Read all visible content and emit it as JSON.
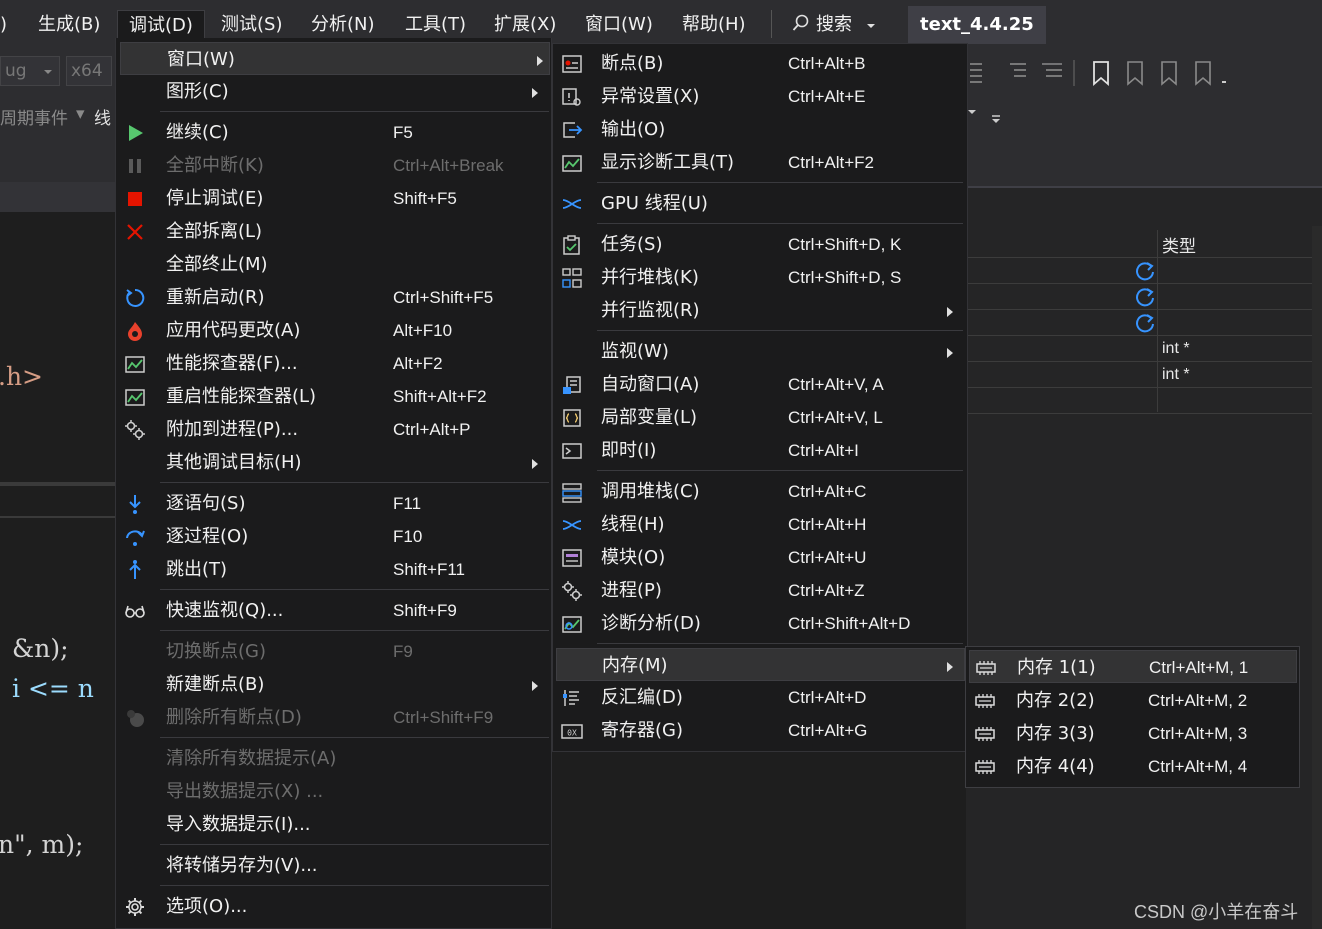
{
  "menubar": {
    "items": [
      ")",
      "生成(B)",
      "调试(D)",
      "测试(S)",
      "分析(N)",
      "工具(T)",
      "扩展(X)",
      "窗口(W)",
      "帮助(H)"
    ],
    "search_label": "搜索",
    "project_title": "text_4.4.25"
  },
  "toolbar": {
    "config": "ug",
    "platform": "x64"
  },
  "nav": {
    "lifecycle": "周期事件",
    "thread_prefix": "线"
  },
  "editor": {
    "code_lines": [
      ".h>",
      "&n);",
      "i <= n",
      "n\", m);"
    ]
  },
  "right_panel": {
    "column_header": "类型",
    "rows": [
      "",
      "",
      "",
      "int *",
      "int *",
      ""
    ]
  },
  "debug_menu": {
    "items": [
      {
        "label": "窗口(W)",
        "shortcut": "",
        "submenu": true,
        "icon": ""
      },
      {
        "label": "图形(C)",
        "shortcut": "",
        "submenu": true,
        "icon": ""
      },
      {
        "label": "继续(C)",
        "shortcut": "F5",
        "icon": "continue-icon"
      },
      {
        "label": "全部中断(K)",
        "shortcut": "Ctrl+Alt+Break",
        "disabled": true,
        "icon": "pause-icon"
      },
      {
        "label": "停止调试(E)",
        "shortcut": "Shift+F5",
        "icon": "stop-icon"
      },
      {
        "label": "全部拆离(L)",
        "shortcut": "",
        "icon": "detach-icon"
      },
      {
        "label": "全部终止(M)",
        "shortcut": "",
        "icon": ""
      },
      {
        "label": "重新启动(R)",
        "shortcut": "Ctrl+Shift+F5",
        "icon": "restart-icon"
      },
      {
        "label": "应用代码更改(A)",
        "shortcut": "Alt+F10",
        "icon": "hot-reload-icon"
      },
      {
        "label": "性能探查器(F)...",
        "shortcut": "Alt+F2",
        "icon": "profiler-icon"
      },
      {
        "label": "重启性能探查器(L)",
        "shortcut": "Shift+Alt+F2",
        "icon": "profiler-restart-icon"
      },
      {
        "label": "附加到进程(P)...",
        "shortcut": "Ctrl+Alt+P",
        "icon": "attach-icon"
      },
      {
        "label": "其他调试目标(H)",
        "shortcut": "",
        "submenu": true,
        "icon": ""
      },
      {
        "label": "逐语句(S)",
        "shortcut": "F11",
        "icon": "step-into-icon"
      },
      {
        "label": "逐过程(O)",
        "shortcut": "F10",
        "icon": "step-over-icon"
      },
      {
        "label": "跳出(T)",
        "shortcut": "Shift+F11",
        "icon": "step-out-icon"
      },
      {
        "label": "快速监视(Q)...",
        "shortcut": "Shift+F9",
        "icon": "glasses-icon"
      },
      {
        "label": "切换断点(G)",
        "shortcut": "F9",
        "disabled": true,
        "icon": ""
      },
      {
        "label": "新建断点(B)",
        "shortcut": "",
        "submenu": true,
        "icon": ""
      },
      {
        "label": "删除所有断点(D)",
        "shortcut": "Ctrl+Shift+F9",
        "disabled": true,
        "icon": "delete-breakpoints-icon"
      },
      {
        "label": "清除所有数据提示(A)",
        "shortcut": "",
        "disabled": true,
        "icon": ""
      },
      {
        "label": "导出数据提示(X) ...",
        "shortcut": "",
        "disabled": true,
        "icon": ""
      },
      {
        "label": "导入数据提示(I)...",
        "shortcut": "",
        "icon": ""
      },
      {
        "label": "将转储另存为(V)...",
        "shortcut": "",
        "icon": ""
      },
      {
        "label": "选项(O)...",
        "shortcut": "",
        "icon": "gear-icon"
      }
    ]
  },
  "window_menu": {
    "items": [
      {
        "label": "断点(B)",
        "shortcut": "Ctrl+Alt+B",
        "icon": "breakpoints-window-icon"
      },
      {
        "label": "异常设置(X)",
        "shortcut": "Ctrl+Alt+E",
        "icon": "exception-settings-icon"
      },
      {
        "label": "输出(O)",
        "shortcut": "",
        "icon": "output-icon"
      },
      {
        "label": "显示诊断工具(T)",
        "shortcut": "Ctrl+Alt+F2",
        "icon": "diagnostics-icon"
      },
      {
        "label": "GPU 线程(U)",
        "shortcut": "",
        "icon": "gpu-threads-icon"
      },
      {
        "label": "任务(S)",
        "shortcut": "Ctrl+Shift+D, K",
        "icon": "tasks-icon"
      },
      {
        "label": "并行堆栈(K)",
        "shortcut": "Ctrl+Shift+D, S",
        "icon": "parallel-stacks-icon"
      },
      {
        "label": "并行监视(R)",
        "shortcut": "",
        "submenu": true,
        "icon": ""
      },
      {
        "label": "监视(W)",
        "shortcut": "",
        "submenu": true,
        "icon": ""
      },
      {
        "label": "自动窗口(A)",
        "shortcut": "Ctrl+Alt+V, A",
        "icon": "autos-icon"
      },
      {
        "label": "局部变量(L)",
        "shortcut": "Ctrl+Alt+V, L",
        "icon": "locals-icon"
      },
      {
        "label": "即时(I)",
        "shortcut": "Ctrl+Alt+I",
        "icon": "immediate-icon"
      },
      {
        "label": "调用堆栈(C)",
        "shortcut": "Ctrl+Alt+C",
        "icon": "call-stack-icon"
      },
      {
        "label": "线程(H)",
        "shortcut": "Ctrl+Alt+H",
        "icon": "threads-icon"
      },
      {
        "label": "模块(O)",
        "shortcut": "Ctrl+Alt+U",
        "icon": "modules-icon"
      },
      {
        "label": "进程(P)",
        "shortcut": "Ctrl+Alt+Z",
        "icon": "processes-icon"
      },
      {
        "label": "诊断分析(D)",
        "shortcut": "Ctrl+Shift+Alt+D",
        "icon": "diagnostic-analysis-icon"
      },
      {
        "label": "内存(M)",
        "shortcut": "",
        "submenu": true,
        "icon": ""
      },
      {
        "label": "反汇编(D)",
        "shortcut": "Ctrl+Alt+D",
        "icon": "disassembly-icon"
      },
      {
        "label": "寄存器(G)",
        "shortcut": "Ctrl+Alt+G",
        "icon": "registers-icon"
      }
    ]
  },
  "memory_menu": {
    "items": [
      {
        "label": "内存 1(1)",
        "shortcut": "Ctrl+Alt+M, 1",
        "icon": "memory-chip-icon"
      },
      {
        "label": "内存 2(2)",
        "shortcut": "Ctrl+Alt+M, 2",
        "icon": "memory-chip-icon"
      },
      {
        "label": "内存 3(3)",
        "shortcut": "Ctrl+Alt+M, 3",
        "icon": "memory-chip-icon"
      },
      {
        "label": "内存 4(4)",
        "shortcut": "Ctrl+Alt+M, 4",
        "icon": "memory-chip-icon"
      }
    ]
  },
  "watermark": "CSDN @小羊在奋斗",
  "colors": {
    "menu_bg": "#1b1b1c",
    "highlight": "#333334",
    "disabled_text": "#6d6d6d",
    "accent_blue": "#3794ff",
    "stop_red": "#e51400",
    "continue_green": "#57c76e"
  }
}
